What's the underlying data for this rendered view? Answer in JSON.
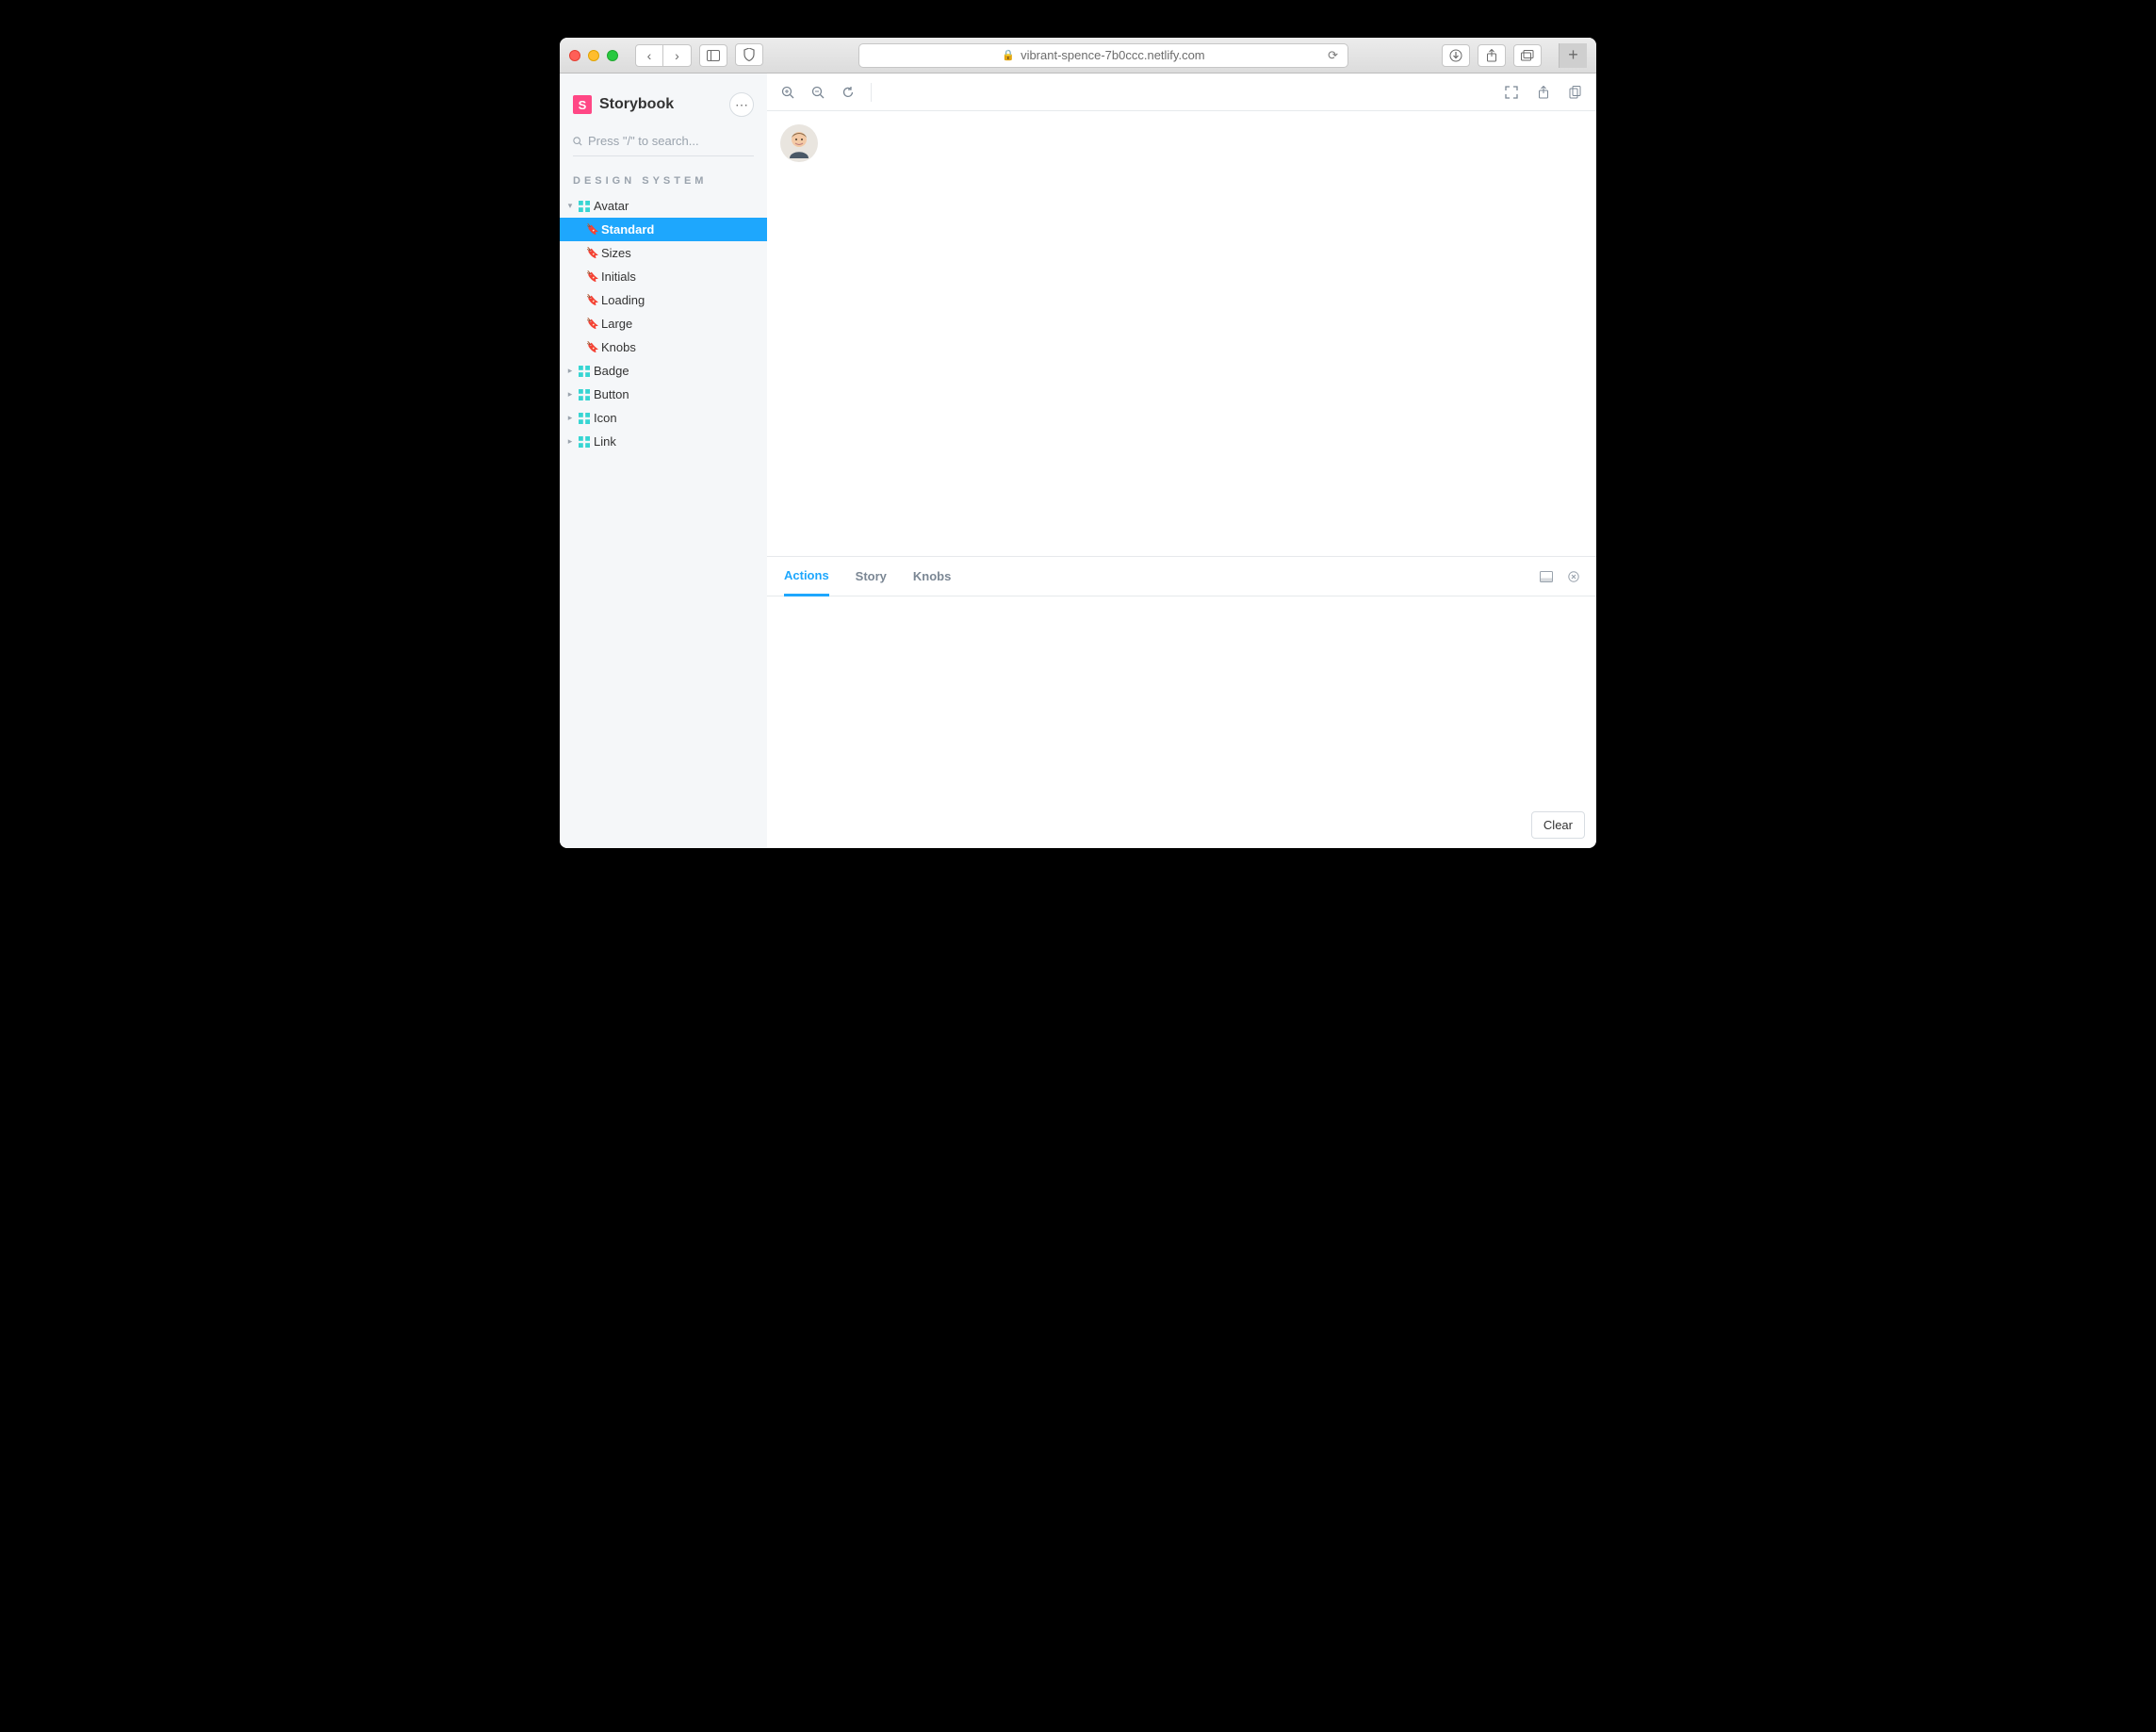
{
  "browser": {
    "url_host": "vibrant-spence-7b0ccc.netlify.com",
    "shield_icon": "shield",
    "back_icon": "‹",
    "forward_icon": "›",
    "sidebar_icon": "sidebar",
    "download_icon": "download",
    "share_icon": "share",
    "tabs_icon": "tabs",
    "new_tab_icon": "+"
  },
  "app": {
    "brand": "Storybook",
    "brand_mark": "S",
    "search_placeholder": "Press \"/\" to search...",
    "section_label": "DESIGN SYSTEM"
  },
  "tree": {
    "components": [
      {
        "name": "Avatar",
        "expanded": true,
        "stories": [
          {
            "name": "Standard",
            "selected": true
          },
          {
            "name": "Sizes"
          },
          {
            "name": "Initials"
          },
          {
            "name": "Loading"
          },
          {
            "name": "Large"
          },
          {
            "name": "Knobs"
          }
        ]
      },
      {
        "name": "Badge"
      },
      {
        "name": "Button"
      },
      {
        "name": "Icon"
      },
      {
        "name": "Link"
      }
    ]
  },
  "canvas_toolbar": {
    "icons": [
      "zoom-in",
      "zoom-out",
      "reset-zoom"
    ],
    "right_icons": [
      "fullscreen",
      "open-new",
      "copy"
    ]
  },
  "addon_panel": {
    "tabs": [
      {
        "label": "Actions",
        "active": true
      },
      {
        "label": "Story"
      },
      {
        "label": "Knobs"
      }
    ],
    "right_icons": [
      "panel-position",
      "close"
    ],
    "clear_label": "Clear"
  },
  "colors": {
    "accent": "#1ea7fd",
    "brand": "#ff4785",
    "teal": "#37d5d3"
  }
}
